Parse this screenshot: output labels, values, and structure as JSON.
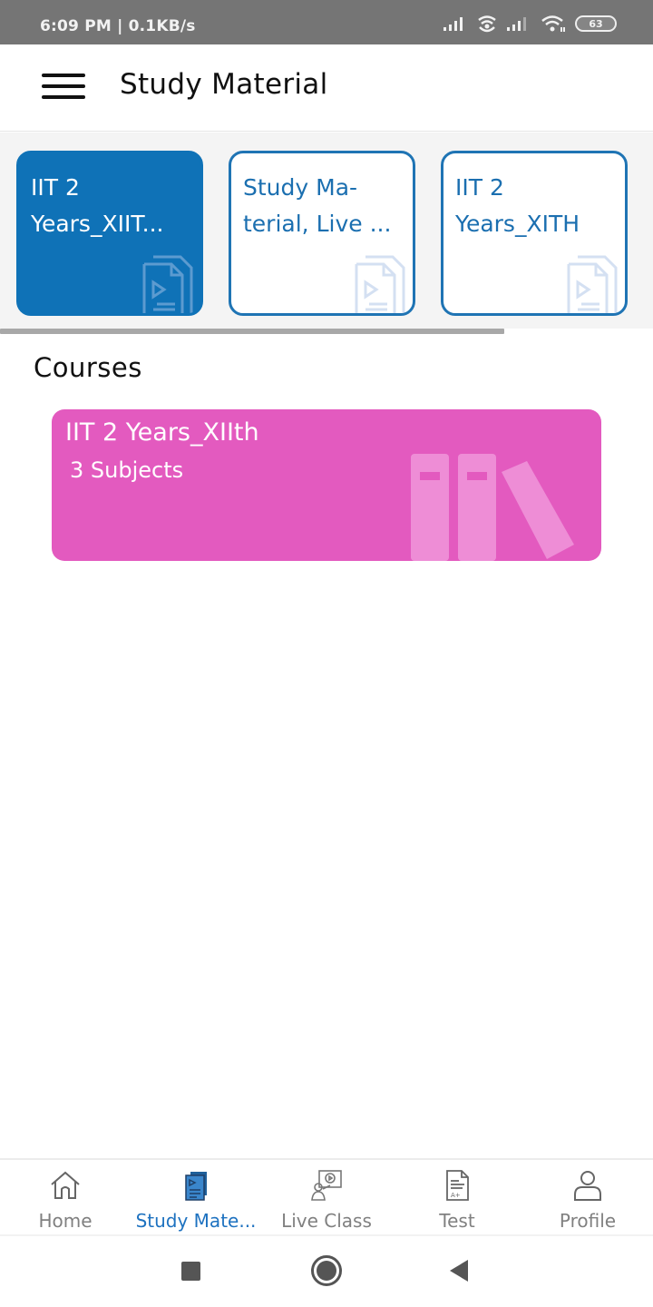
{
  "status_bar": {
    "time": "6:09 PM | 0.1KB/s",
    "battery": "63",
    "icons": [
      "signal-icon",
      "hotspot-icon",
      "signal-icon",
      "wifi-icon",
      "battery-icon"
    ]
  },
  "app_bar": {
    "menu_icon": "hamburger-menu-icon",
    "title": "Study Material"
  },
  "batches": [
    {
      "label": "IIT 2 Years_XIIT...",
      "active": true,
      "icon": "document-video-icon"
    },
    {
      "label": "Study Ma- terial, Live ...",
      "active": false,
      "icon": "document-video-icon"
    },
    {
      "label": "IIT 2 Years_XITH",
      "active": false,
      "icon": "document-video-icon"
    }
  ],
  "courses_section": {
    "title": "Courses",
    "items": [
      {
        "name": "IIT 2 Years_XIIth",
        "subtitle": "3 Subjects",
        "color": "#e35abf",
        "icon": "books-icon"
      }
    ]
  },
  "bottom_nav": {
    "items": [
      {
        "label": "Home",
        "icon": "home-icon",
        "active": false
      },
      {
        "label": "Study Mate...",
        "icon": "study-material-icon",
        "active": true
      },
      {
        "label": "Live Class",
        "icon": "live-class-icon",
        "active": false
      },
      {
        "label": "Test",
        "icon": "test-icon",
        "active": false
      },
      {
        "label": "Profile",
        "icon": "profile-icon",
        "active": false
      }
    ]
  },
  "colors": {
    "primary": "#0f72b7",
    "active_nav": "#1e72c0",
    "course_card": "#e35abf",
    "status_bar": "#757575"
  }
}
